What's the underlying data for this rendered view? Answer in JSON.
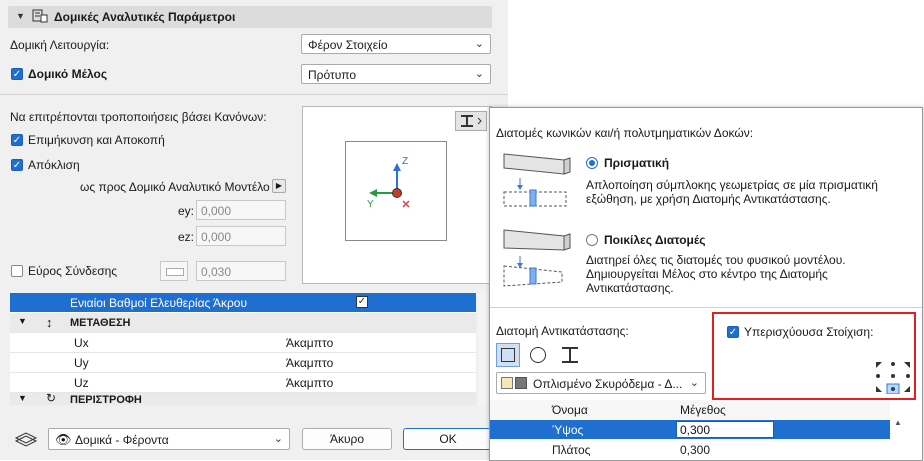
{
  "main": {
    "section_title": "Δομικές Αναλυτικές Παράμετροι",
    "structural_function_label": "Δομική Λειτουργία:",
    "structural_function_value": "Φέρον Στοιχείο",
    "structural_member_label": "Δομικό Μέλος",
    "structural_member_value": "Πρότυπο",
    "rules_label": "Να επιτρέπονται τροποποιήσεις βάσει Κανόνων:",
    "lengthening_label": "Επιμήκυνση και Αποκοπή",
    "offset_label": "Απόκλιση",
    "relative_label": "ως προς Δομικό Αναλυτικό Μοντέλο",
    "ey_label": "ey:",
    "ey_value": "0,000",
    "ez_label": "ez:",
    "ez_value": "0,000",
    "joint_width_label": "Εύρος Σύνδεσης",
    "joint_width_value": "0,030",
    "axis_z": "Z",
    "axis_y": "Y"
  },
  "table": {
    "header": "Ενιαίοι Βαθμοί Ελευθερίας Άκρου",
    "group1": "ΜΕΤΑΘΕΣΗ",
    "rows": [
      {
        "name": "Ux",
        "value": "Άκαμπτο"
      },
      {
        "name": "Uy",
        "value": "Άκαμπτο"
      },
      {
        "name": "Uz",
        "value": "Άκαμπτο"
      }
    ],
    "group2": "ΠΕΡΙΣΤΡΟΦΗ"
  },
  "bottom": {
    "layer_value": "Δομικά - Φέροντα",
    "cancel_label": "Άκυρο",
    "ok_label": "OK"
  },
  "popup": {
    "title": "Διατομές κωνικών και/ή πολυτμηματικών Δοκών:",
    "prismatic_label": "Πρισματική",
    "prismatic_desc_1": "Απλοποίηση σύμπλοκης γεωμετρίας σε μία πρισματική",
    "prismatic_desc_2": "εξώθηση, με χρήση Διατομής Αντικατάστασης.",
    "various_label": "Ποικίλες Διατομές",
    "various_desc_1": "Διατηρεί όλες τις διατομές του φυσικού μοντέλου.",
    "various_desc_2": "Δημιουργείται Μέλος στο κέντρο της Διατομής",
    "various_desc_3": "Αντικατάστασης.",
    "replacement_label": "Διατομή Αντικατάστασης:",
    "overriding_label": "Υπερισχύουσα Στοίχιση:",
    "material_value": "Οπλισμένο Σκυρόδεμα - Δ...",
    "col_name": "Όνομα",
    "col_size": "Μέγεθος",
    "rows": [
      {
        "name": "Ύψος",
        "value": "0,300"
      },
      {
        "name": "Πλάτος",
        "value": "0,300"
      }
    ]
  },
  "colors": {
    "accent": "#1f6fd1",
    "highlight": "#e02020"
  }
}
